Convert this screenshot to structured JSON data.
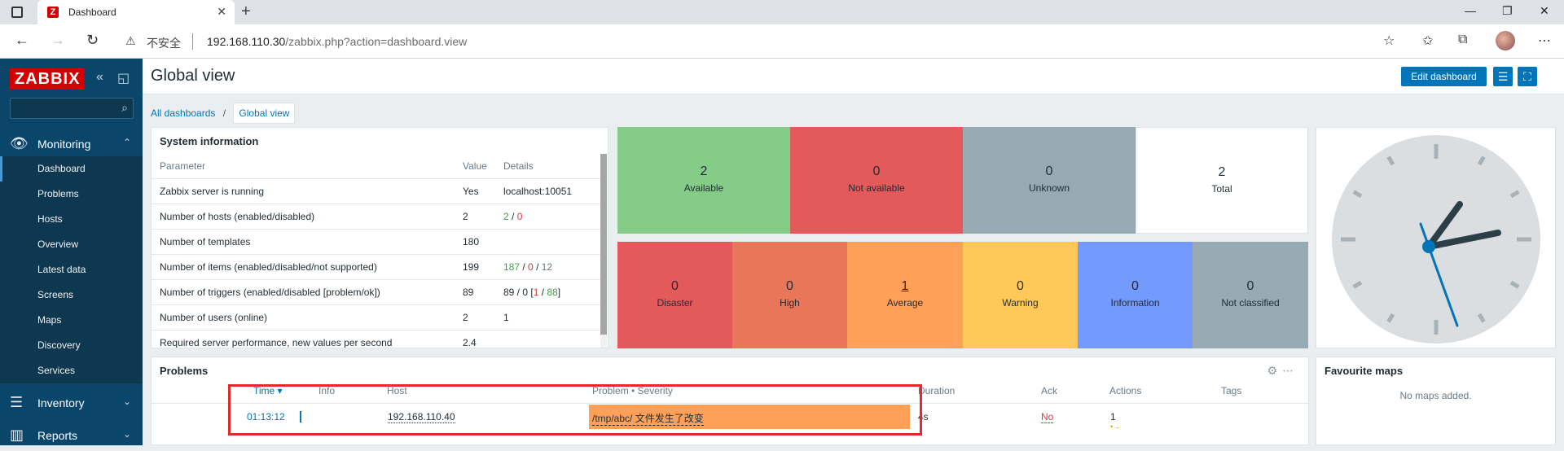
{
  "browser": {
    "tab_title": "Dashboard",
    "tab_favicon": "Z",
    "insecure_label": "不安全",
    "url_host": "192.168.110.30",
    "url_path": "/zabbix.php?action=dashboard.view"
  },
  "sidebar": {
    "logo": "ZABBIX",
    "monitoring": {
      "label": "Monitoring",
      "items": [
        "Dashboard",
        "Problems",
        "Hosts",
        "Overview",
        "Latest data",
        "Screens",
        "Maps",
        "Discovery",
        "Services"
      ]
    },
    "inventory": "Inventory",
    "reports": "Reports"
  },
  "header": {
    "title": "Global view",
    "edit_button": "Edit dashboard"
  },
  "breadcrumbs": {
    "all": "All dashboards",
    "current": "Global view"
  },
  "sysinfo": {
    "title": "System information",
    "columns": [
      "Parameter",
      "Value",
      "Details"
    ],
    "rows": [
      {
        "param": "Zabbix server is running",
        "value": "Yes",
        "details": "localhost:10051"
      },
      {
        "param": "Number of hosts (enabled/disabled)",
        "value": "2",
        "d1": "2",
        "d2": "0"
      },
      {
        "param": "Number of templates",
        "value": "180",
        "details": ""
      },
      {
        "param": "Number of items (enabled/disabled/not supported)",
        "value": "199",
        "d1": "187",
        "d2": "0",
        "d3": "12"
      },
      {
        "param": "Number of triggers (enabled/disabled [problem/ok])",
        "value": "89",
        "d0": "89 / 0 [",
        "d1": "1",
        "d2": "88",
        "d3": "]"
      },
      {
        "param": "Number of users (online)",
        "value": "2",
        "details": "1"
      },
      {
        "param": "Required server performance, new values per second",
        "value": "2.4",
        "details": ""
      }
    ]
  },
  "host_availability": [
    {
      "num": "2",
      "label": "Available",
      "color": "#86cc89"
    },
    {
      "num": "0",
      "label": "Not available",
      "color": "#e45959"
    },
    {
      "num": "0",
      "label": "Unknown",
      "color": "#97aab3"
    },
    {
      "num": "2",
      "label": "Total",
      "color": "#ffffff"
    }
  ],
  "severity": [
    {
      "num": "0",
      "label": "Disaster",
      "color": "#e45959"
    },
    {
      "num": "0",
      "label": "High",
      "color": "#e97659"
    },
    {
      "num": "1",
      "label": "Average",
      "color": "#ffa059"
    },
    {
      "num": "0",
      "label": "Warning",
      "color": "#ffc859"
    },
    {
      "num": "0",
      "label": "Information",
      "color": "#7499ff"
    },
    {
      "num": "0",
      "label": "Not classified",
      "color": "#97aab3"
    }
  ],
  "problems": {
    "title": "Problems",
    "columns": {
      "time": "Time ▾",
      "info": "Info",
      "host": "Host",
      "problem": "Problem • Severity",
      "duration": "Duration",
      "ack": "Ack",
      "actions": "Actions",
      "tags": "Tags"
    },
    "row": {
      "time": "01:13:12",
      "host": "192.168.110.40",
      "problem": "/tmp/abc/ 文件发生了改变",
      "duration": "4s",
      "ack": "No",
      "actions": "1"
    }
  },
  "favmaps": {
    "title": "Favourite maps",
    "empty": "No maps added."
  }
}
